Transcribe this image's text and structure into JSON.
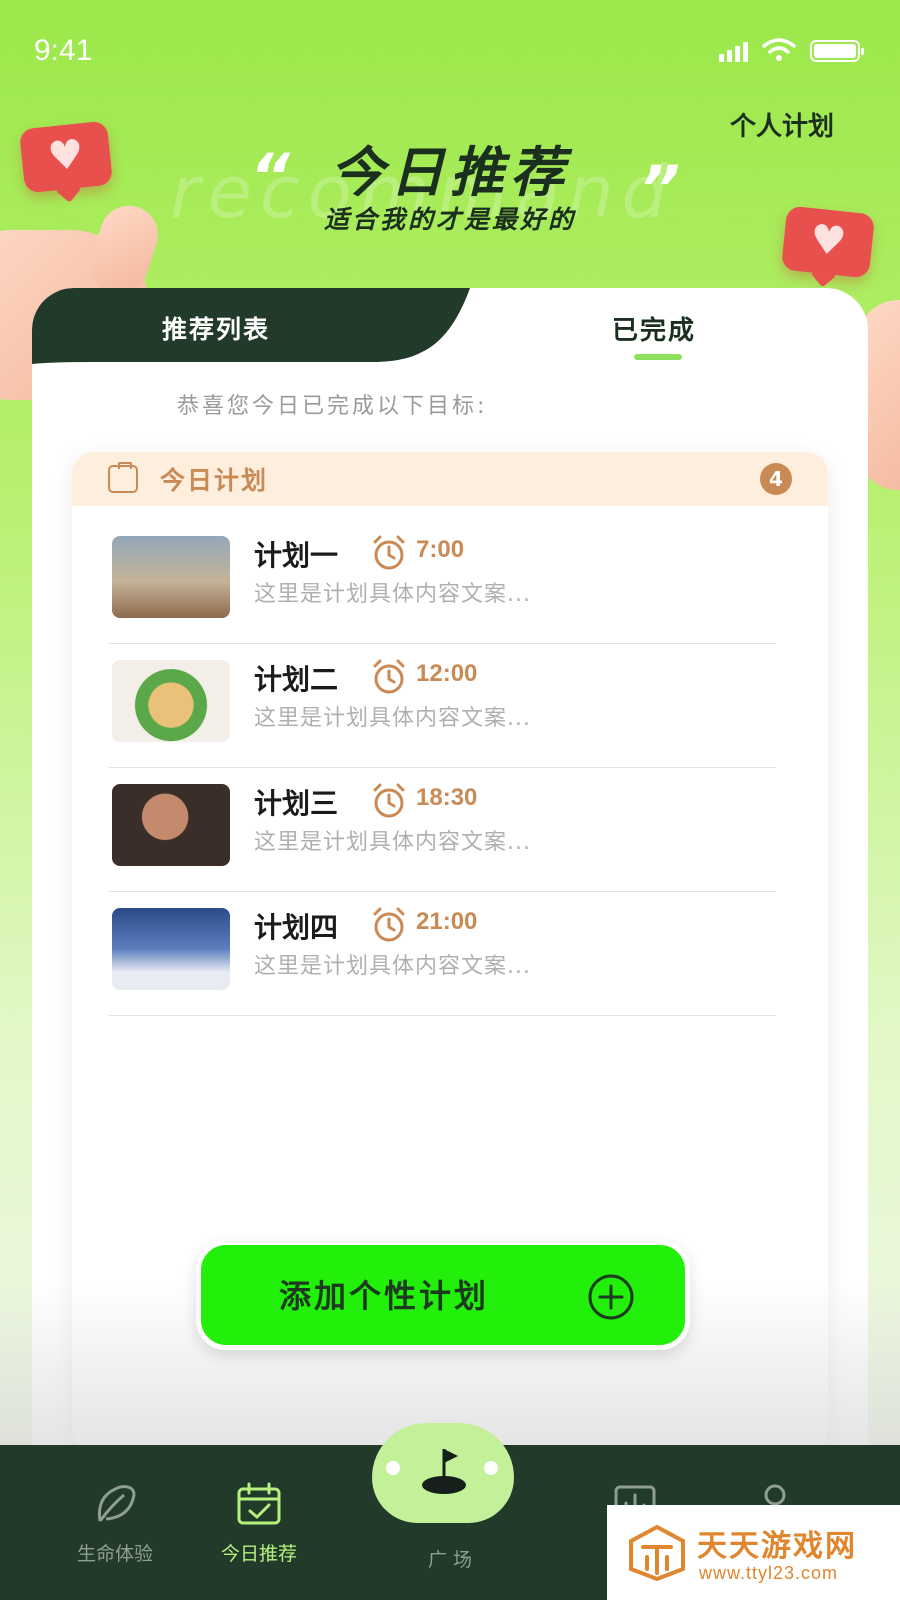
{
  "status": {
    "time": "9:41"
  },
  "header": {
    "personal_plan": "个人计划",
    "watermark": "recommand",
    "title": "今日推荐",
    "subtitle": "适合我的才是最好的",
    "quote_open": "“",
    "quote_close": "”"
  },
  "tabs": {
    "recommend_list": "推荐列表",
    "completed": "已完成"
  },
  "congrats_text": "恭喜您今日已完成以下目标:",
  "plan_card": {
    "title": "今日计划",
    "count": "4",
    "items": [
      {
        "name": "计划一",
        "time": "7:00",
        "desc": "这里是计划具体内容文案...",
        "image": "runner-photo"
      },
      {
        "name": "计划二",
        "time": "12:00",
        "desc": "这里是计划具体内容文案...",
        "image": "salad-photo"
      },
      {
        "name": "计划三",
        "time": "18:30",
        "desc": "这里是计划具体内容文案...",
        "image": "dumbbell-photo"
      },
      {
        "name": "计划四",
        "time": "21:00",
        "desc": "这里是计划具体内容文案...",
        "image": "sleeping-photo"
      }
    ]
  },
  "add_button": {
    "label": "添加个性计划"
  },
  "bottom_nav": [
    {
      "label": "生命体验",
      "icon": "leaf-icon"
    },
    {
      "label": "今日推荐",
      "icon": "calendar-check-icon",
      "active": true
    },
    {
      "label": "广 场",
      "icon": "golf-flag-icon"
    },
    {
      "label": "",
      "icon": "chart-icon"
    },
    {
      "label": "",
      "icon": "user-icon"
    }
  ],
  "overlay": {
    "name": "天天游戏网",
    "url": "www.ttyl23.com"
  },
  "colors": {
    "accent_green": "#22f00a",
    "dark_green": "#223a2a",
    "orange": "#c98a56",
    "active_tab": "#b6f07e"
  }
}
